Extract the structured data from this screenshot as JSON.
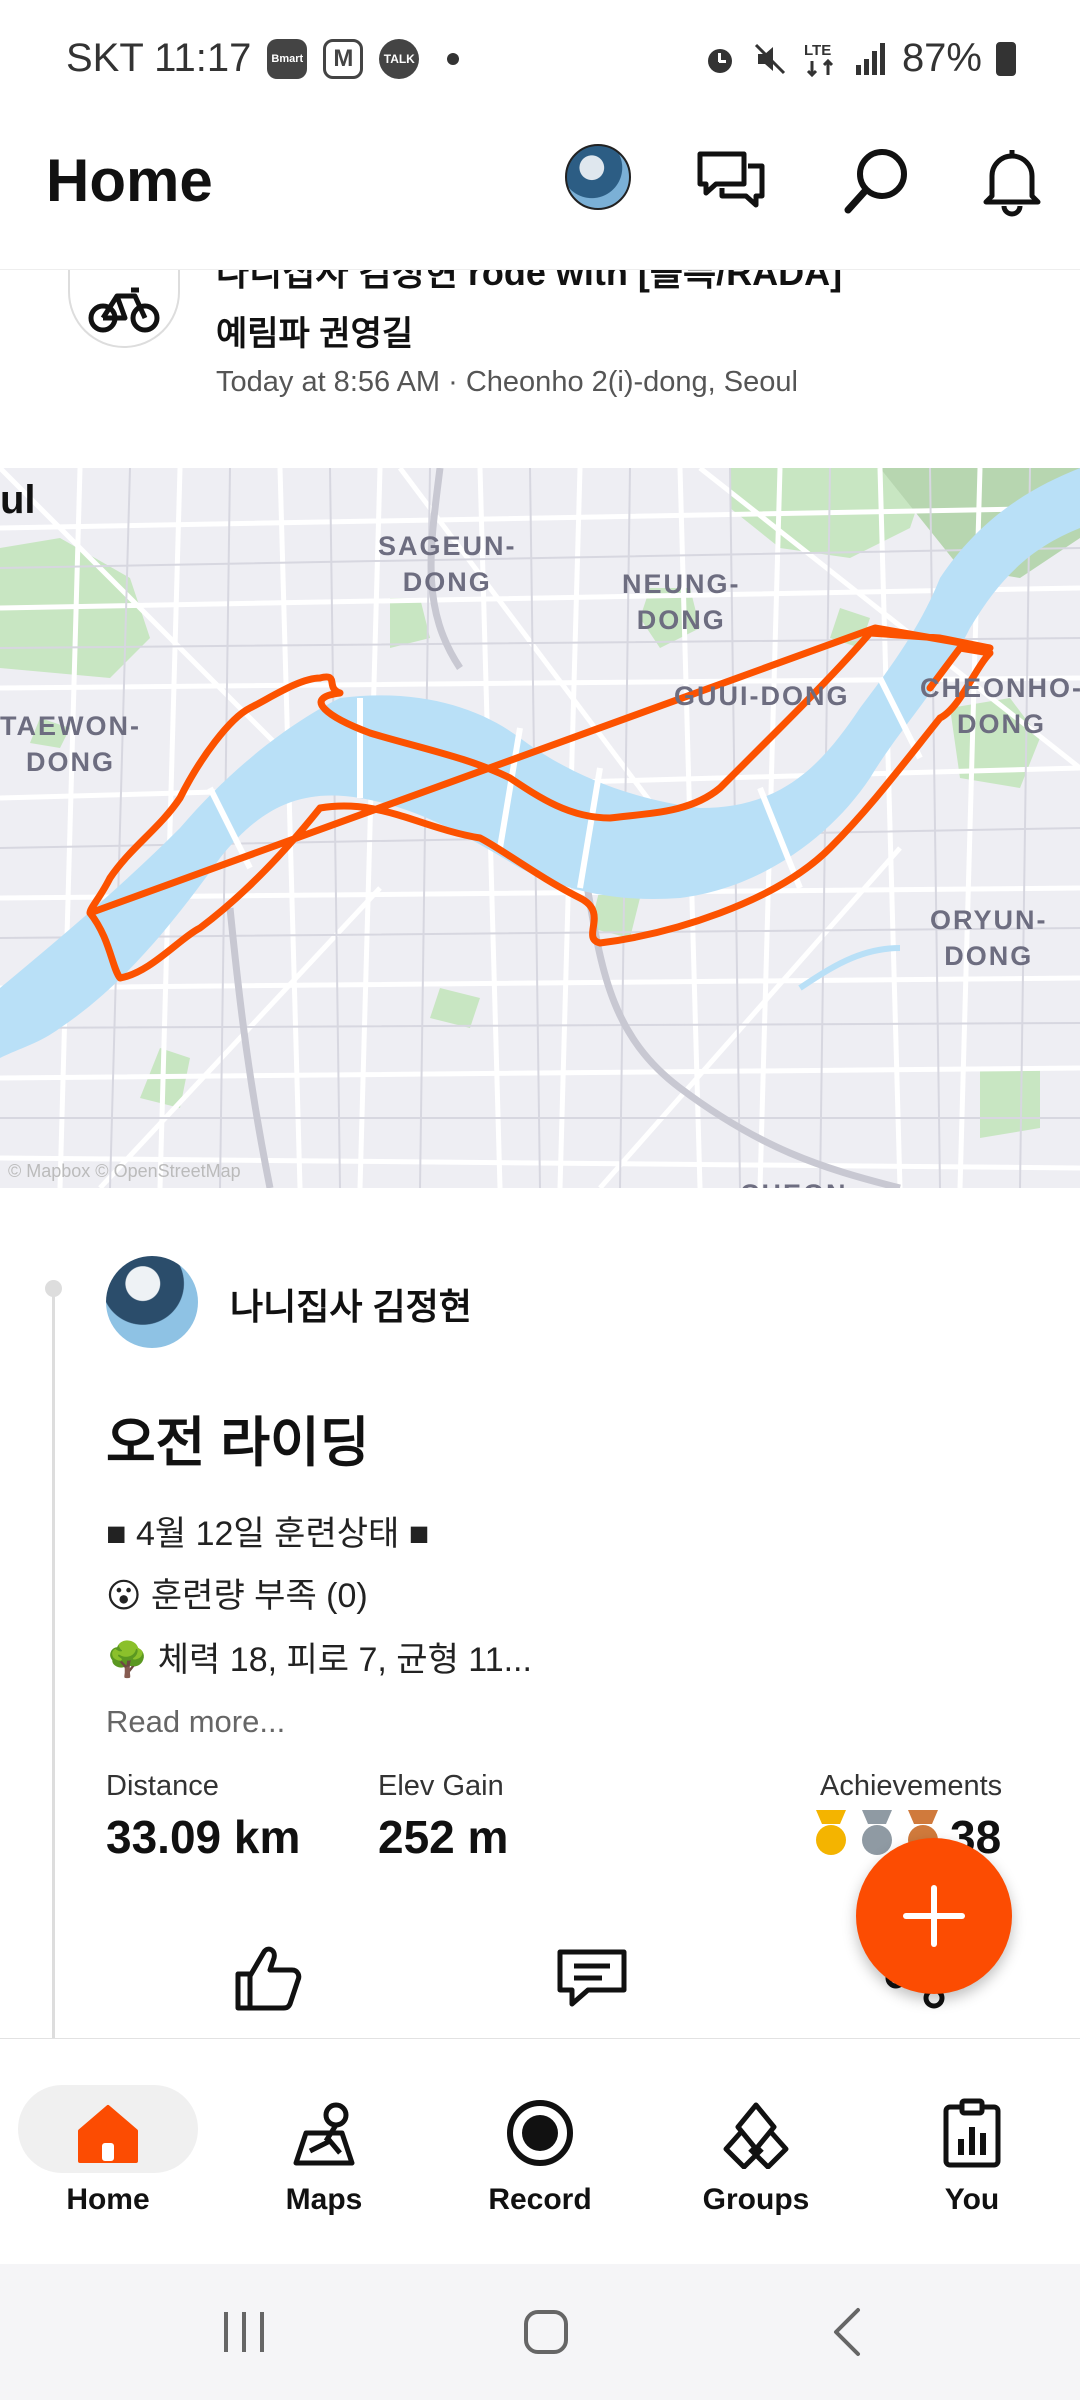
{
  "status_bar": {
    "carrier_time": "SKT 11:17",
    "badges": [
      "Bmart",
      "M",
      "TALK"
    ],
    "battery": "87%",
    "icons": [
      "alarm-icon",
      "mute-icon",
      "lte-icon",
      "signal-icon",
      "battery-icon"
    ]
  },
  "header": {
    "title": "Home",
    "icons": [
      "avatar",
      "chat-icon",
      "search-icon",
      "bell-icon"
    ]
  },
  "activity_prev": {
    "title_cut": "나니집사 김정현 rode with [볼륵/RADA]",
    "title_line2": "예림파 권영길",
    "meta": "Today at 8:56 AM · Cheonho 2(i)-dong, Seoul",
    "more": "···"
  },
  "map": {
    "labels": [
      "ul",
      "SAGEUN-\nDONG",
      "NEUNG-\nDONG",
      "GUUI-DONG",
      "CHEONHO-\nDONG",
      "TAEWON-\nDONG",
      "ORYUN-\nDONG",
      "CHEON"
    ],
    "attribution": "© Mapbox © OpenStreetMap",
    "route_color": "#fc5200",
    "water_color": "#b9e0f7"
  },
  "activity": {
    "user_name": "나니집사 김정현",
    "title": "오전 라이딩",
    "desc_line1": "■ 4월 12일 훈련상태 ■",
    "desc_line2": "😮 훈련량 부족 (0)",
    "desc_line3": "🌳 체력 18, 피로 7, 균형 11...",
    "read_more": "Read more...",
    "stats": {
      "distance_label": "Distance",
      "distance_value": "33.09 km",
      "elev_label": "Elev Gain",
      "elev_value": "252 m",
      "ach_label": "Achievements",
      "ach_value": "38"
    },
    "action_icons": [
      "thumbs-up-icon",
      "comment-icon",
      "share-icon"
    ]
  },
  "fab": {
    "icon": "plus-icon",
    "color": "#fc4c02"
  },
  "bottom_nav": {
    "items": [
      {
        "label": "Home",
        "icon": "home-icon",
        "active": true
      },
      {
        "label": "Maps",
        "icon": "maps-icon",
        "active": false
      },
      {
        "label": "Record",
        "icon": "record-icon",
        "active": false
      },
      {
        "label": "Groups",
        "icon": "groups-icon",
        "active": false
      },
      {
        "label": "You",
        "icon": "you-icon",
        "active": false
      }
    ]
  },
  "colors": {
    "accent": "#fc4c02"
  }
}
